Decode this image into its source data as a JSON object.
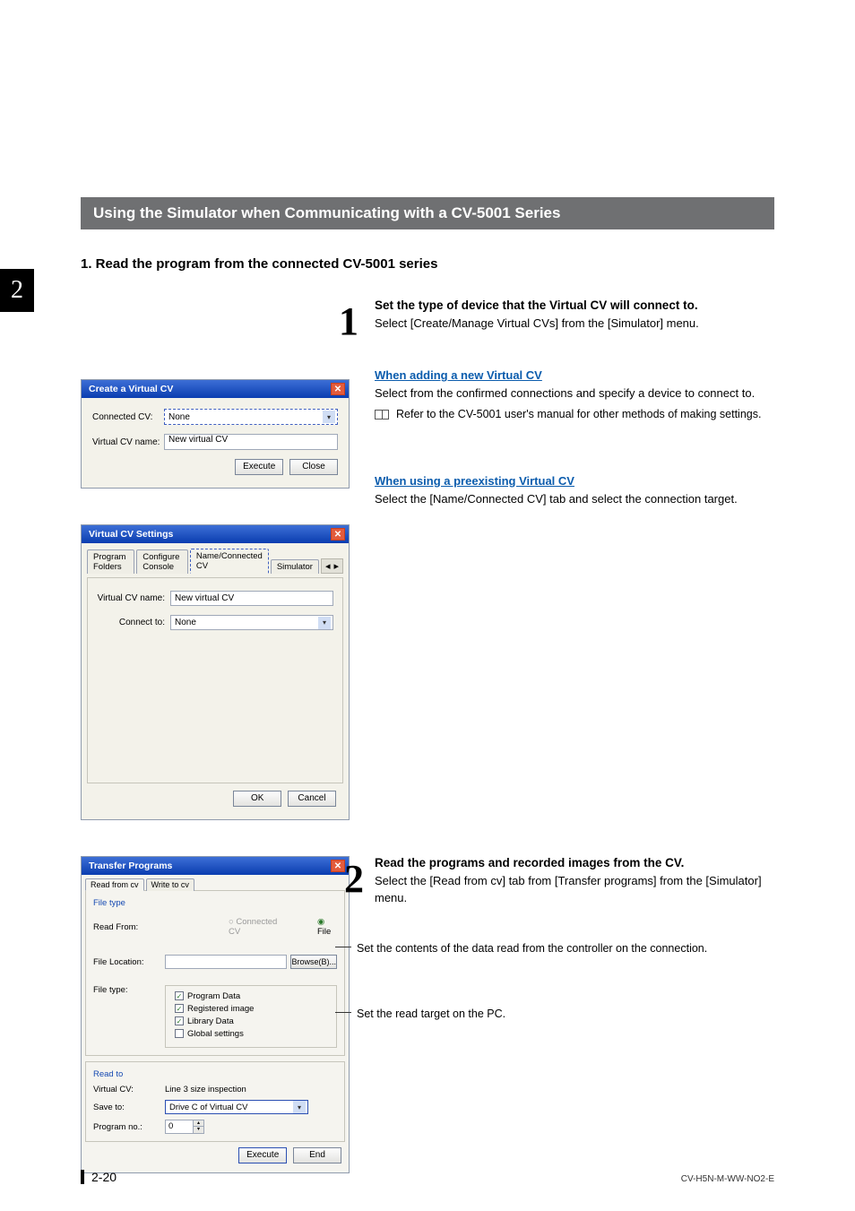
{
  "chapter_tab": "2",
  "section_title": "Using the Simulator when Communicating with a CV-5001 Series",
  "subsection": "1. Read the program from the connected CV-5001 series",
  "step1": {
    "num": "1",
    "title": "Set the type of device that the Virtual CV will connect to.",
    "body": "Select [Create/Manage Virtual CVs] from the [Simulator] menu.",
    "sub_a_head": "When adding a new Virtual CV",
    "sub_a_body": "Select from the confirmed connections and specify a device to connect to.",
    "ref": "Refer to the CV-5001 user's manual for other methods of making settings.",
    "sub_b_head": "When using a preexisting Virtual CV",
    "sub_b_body": "Select the [Name/Connected CV] tab and select the connection target."
  },
  "dlg1": {
    "title": "Create a Virtual CV",
    "l1": "Connected CV:",
    "v1": "None",
    "l2": "Virtual CV name:",
    "v2": "New virtual CV",
    "execute": "Execute",
    "close": "Close"
  },
  "dlg2": {
    "title": "Virtual CV Settings",
    "tabs": [
      "Program Folders",
      "Configure Console",
      "Name/Connected CV",
      "Simulator"
    ],
    "nav": [
      "◂",
      "▸"
    ],
    "l1": "Virtual CV name:",
    "v1": "New virtual CV",
    "l2": "Connect to:",
    "v2": "None",
    "ok": "OK",
    "cancel": "Cancel"
  },
  "step2": {
    "num": "2",
    "title": "Read the programs and recorded images from the CV.",
    "body": "Select the [Read from cv] tab from [Transfer programs] from the [Simulator] menu."
  },
  "dlg3": {
    "title": "Transfer Programs",
    "tabs": [
      "Read from cv",
      "Write to cv"
    ],
    "group1": "File type",
    "read_from_label": "Read From:",
    "radio_cv": "Connected CV",
    "radio_file": "File",
    "file_loc_label": "File Location:",
    "browse": "Browse(B)...",
    "file_type_label": "File type:",
    "chk": [
      "Program Data",
      "Registered image",
      "Library Data",
      "Global settings"
    ],
    "group2": "Read to",
    "vc_label": "Virtual CV:",
    "vc_value": "Line 3 size inspection",
    "save_label": "Save to:",
    "save_value": "Drive C of Virtual CV",
    "pn_label": "Program no.:",
    "pn_value": "0",
    "execute": "Execute",
    "end": "End"
  },
  "annot1": "Set the contents of the data read from the controller on the connection.",
  "annot2": "Set the read target on the PC.",
  "footer": {
    "page": "2-20",
    "doc": "CV-H5N-M-WW-NO2-E"
  }
}
